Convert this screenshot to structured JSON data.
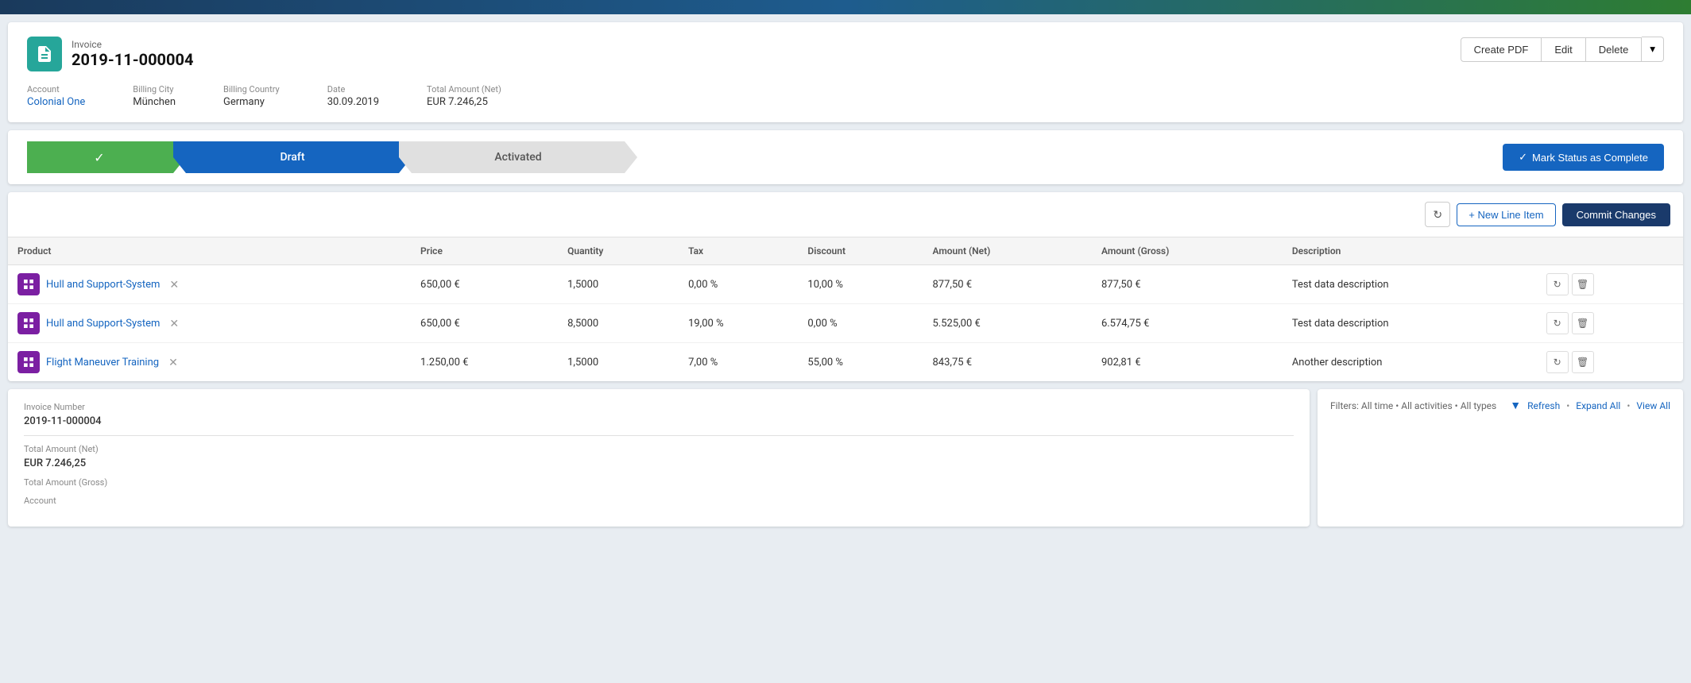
{
  "topbar": {},
  "invoice": {
    "label": "Invoice",
    "number": "2019-11-000004",
    "icon_label": "invoice-icon"
  },
  "actions": {
    "create_pdf": "Create PDF",
    "edit": "Edit",
    "delete": "Delete"
  },
  "meta": {
    "account_label": "Account",
    "account_value": "Colonial One",
    "billing_city_label": "Billing City",
    "billing_city_value": "München",
    "billing_country_label": "Billing Country",
    "billing_country_value": "Germany",
    "date_label": "Date",
    "date_value": "30.09.2019",
    "total_net_label": "Total Amount (Net)",
    "total_net_value": "EUR 7.246,25"
  },
  "status": {
    "done_label": "",
    "draft_label": "Draft",
    "activated_label": "Activated",
    "mark_complete_label": "Mark Status as Complete"
  },
  "line_items": {
    "toolbar": {
      "new_line_label": "+ New Line Item",
      "commit_label": "Commit Changes"
    },
    "columns": {
      "product": "Product",
      "price": "Price",
      "quantity": "Quantity",
      "tax": "Tax",
      "discount": "Discount",
      "amount_net": "Amount (Net)",
      "amount_gross": "Amount (Gross)",
      "description": "Description"
    },
    "rows": [
      {
        "product": "Hull and Support-System",
        "price": "650,00 €",
        "quantity": "1,5000",
        "tax": "0,00 %",
        "discount": "10,00 %",
        "amount_net": "877,50 €",
        "amount_gross": "877,50 €",
        "description": "Test data description"
      },
      {
        "product": "Hull and Support-System",
        "price": "650,00 €",
        "quantity": "8,5000",
        "tax": "19,00 %",
        "discount": "0,00 %",
        "amount_net": "5.525,00 €",
        "amount_gross": "6.574,75 €",
        "description": "Test data description"
      },
      {
        "product": "Flight Maneuver Training",
        "price": "1.250,00 €",
        "quantity": "1,5000",
        "tax": "7,00 %",
        "discount": "55,00 %",
        "amount_net": "843,75 €",
        "amount_gross": "902,81 €",
        "description": "Another description"
      }
    ]
  },
  "summary": {
    "invoice_number_label": "Invoice Number",
    "invoice_number_value": "2019-11-000004",
    "account_label": "Account",
    "total_net_label": "Total Amount (Net)",
    "total_net_value": "EUR 7.246,25",
    "total_gross_label": "Total Amount (Gross)"
  },
  "activity": {
    "filters_label": "Filters: All time • All activities • All types",
    "refresh_label": "Refresh",
    "expand_all_label": "Expand All",
    "view_all_label": "View All"
  }
}
